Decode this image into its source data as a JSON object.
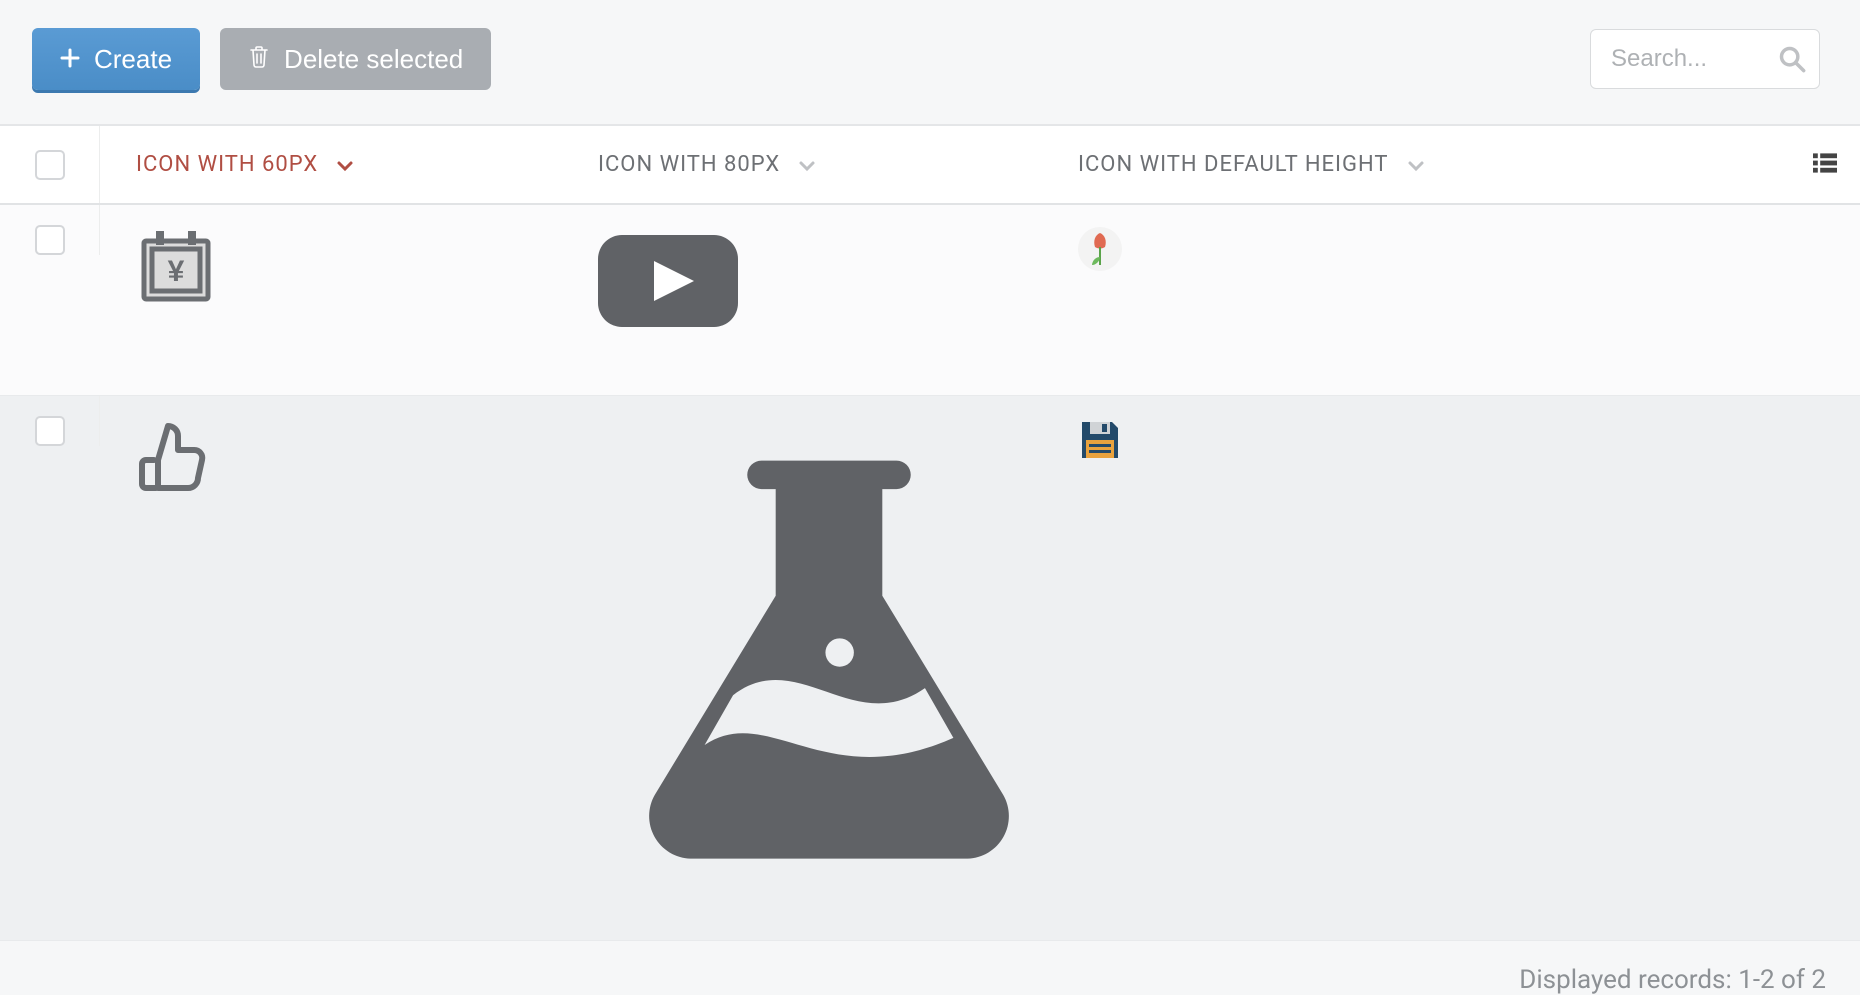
{
  "toolbar": {
    "create_label": "Create",
    "delete_label": "Delete selected",
    "search_placeholder": "Search..."
  },
  "table": {
    "columns": {
      "col_a": "ICON WITH 60PX",
      "col_b": "ICON WITH 80PX",
      "col_c": "ICON WITH DEFAULT HEIGHT"
    },
    "rows": [
      {
        "icon_a": "calendar-yen",
        "icon_b": "youtube",
        "icon_c": "tulip"
      },
      {
        "icon_a": "thumbs-up",
        "icon_b": "flask",
        "icon_c": "floppy-disk"
      }
    ]
  },
  "footer": {
    "text": "Displayed records: 1-2 of 2"
  }
}
